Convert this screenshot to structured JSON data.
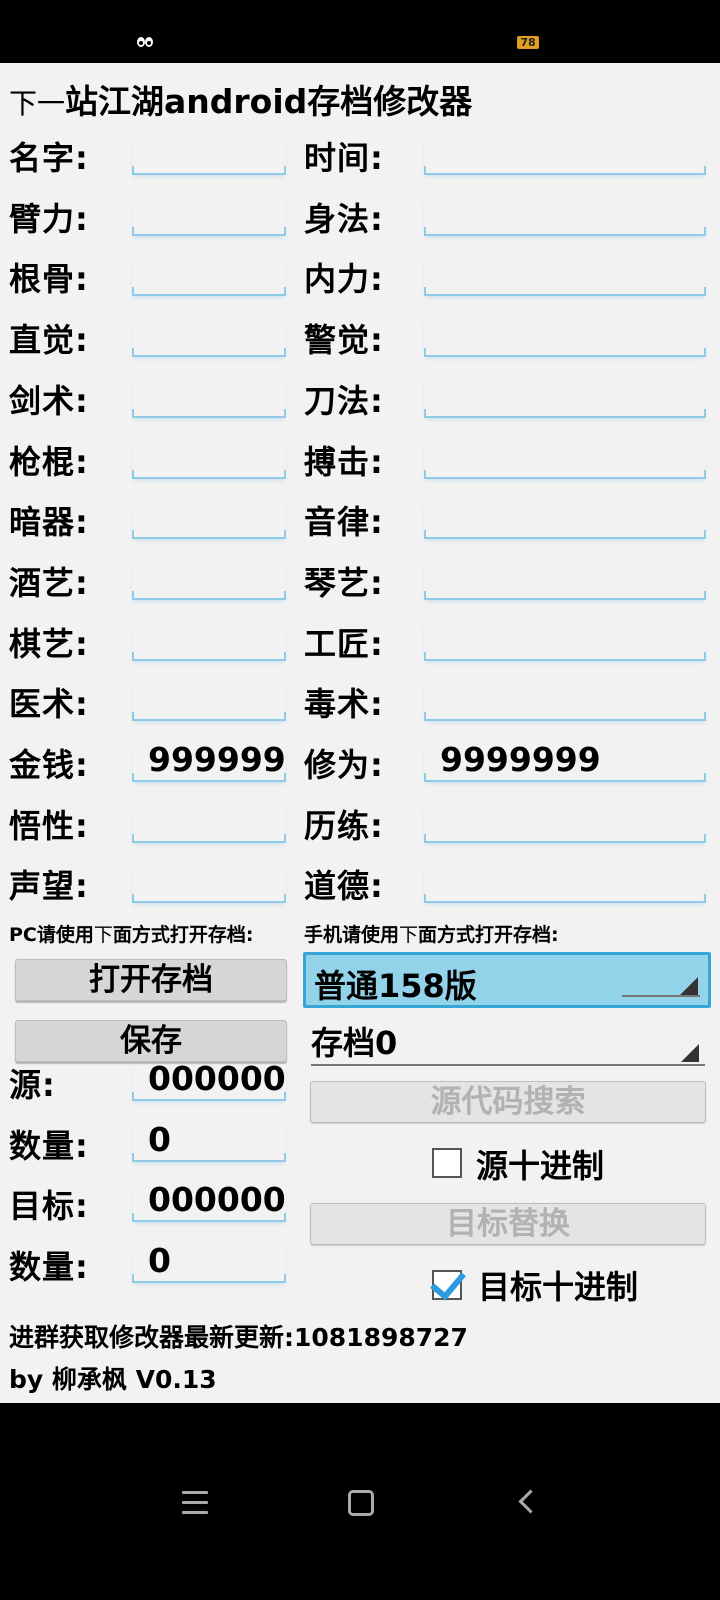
{
  "status_bar": {
    "battery_level": "78",
    "left_icon": "app-notification-icon"
  },
  "title": {
    "small": "下一",
    "main": "站江湖android存档修改器"
  },
  "fields": [
    {
      "left_label": "名字:",
      "left_value": "",
      "right_label": "时间:",
      "right_value": ""
    },
    {
      "left_label": "臂力:",
      "left_value": "",
      "right_label": "身法:",
      "right_value": ""
    },
    {
      "left_label": "根骨:",
      "left_value": "",
      "right_label": "内力:",
      "right_value": ""
    },
    {
      "left_label": "直觉:",
      "left_value": "",
      "right_label": "警觉:",
      "right_value": ""
    },
    {
      "left_label": "剑术:",
      "left_value": "",
      "right_label": "刀法:",
      "right_value": ""
    },
    {
      "left_label": "枪棍:",
      "left_value": "",
      "right_label": "搏击:",
      "right_value": ""
    },
    {
      "left_label": "暗器:",
      "left_value": "",
      "right_label": "音律:",
      "right_value": ""
    },
    {
      "left_label": "酒艺:",
      "left_value": "",
      "right_label": "琴艺:",
      "right_value": ""
    },
    {
      "left_label": "棋艺:",
      "left_value": "",
      "right_label": "工匠:",
      "right_value": ""
    },
    {
      "left_label": "医术:",
      "left_value": "",
      "right_label": "毒术:",
      "right_value": ""
    },
    {
      "left_label": "金钱:",
      "left_value": "999999",
      "right_label": "修为:",
      "right_value": "9999999"
    },
    {
      "left_label": "悟性:",
      "left_value": "",
      "right_label": "历练:",
      "right_value": ""
    },
    {
      "left_label": "声望:",
      "left_value": "",
      "right_label": "道德:",
      "right_value": ""
    }
  ],
  "hints": {
    "pc_prefix": "PC请使用",
    "pc_small": "下",
    "pc_suffix": "面方式打开存档:",
    "phone_prefix": "手机请使用",
    "phone_small": "下",
    "phone_suffix": "面方式打开存档:"
  },
  "buttons": {
    "open": "打开存档",
    "save": "保存",
    "source_search": "源代码搜索",
    "target_replace": "目标替换"
  },
  "spinners": {
    "version": "普通158版",
    "slot": "存档0"
  },
  "search": {
    "source_label": "源:",
    "source_value": "000000",
    "source_count_label": "数量:",
    "source_count_value": "0",
    "source_decimal_label": "源十进制",
    "source_decimal_checked": false,
    "target_label": "目标:",
    "target_value": "000000",
    "target_count_label": "数量:",
    "target_count_value": "0",
    "target_decimal_label": "目标十进制",
    "target_decimal_checked": true
  },
  "footer": {
    "group_text": "进群获取修改器最新更新:1081898727",
    "author_text": "by 柳承枫 V0.13"
  },
  "navbar": {
    "icons": [
      "menu-icon",
      "home-icon",
      "back-icon"
    ]
  }
}
